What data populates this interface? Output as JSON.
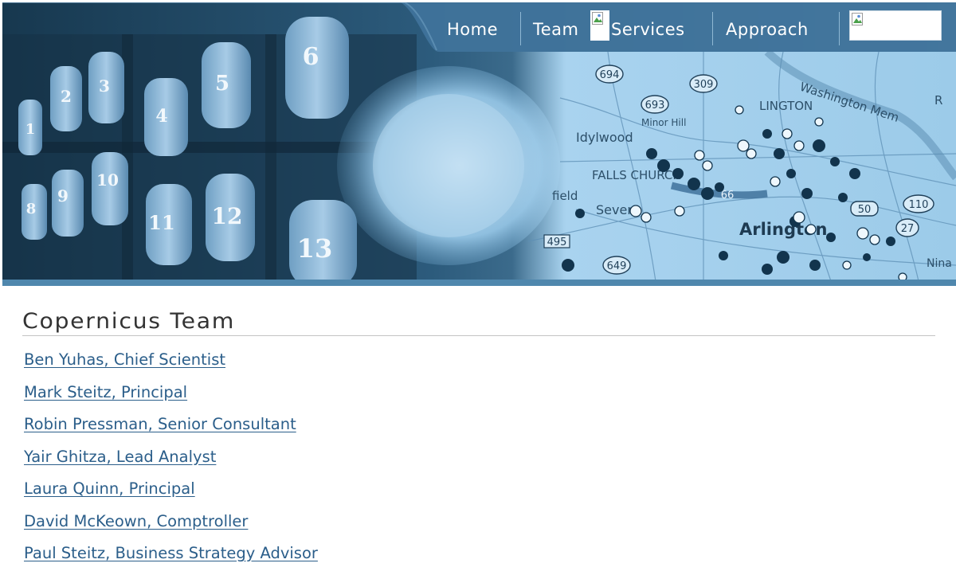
{
  "nav": {
    "items": [
      {
        "label": "Home"
      },
      {
        "label": "Team"
      },
      {
        "label": "Services"
      },
      {
        "label": "Approach"
      }
    ]
  },
  "banner": {
    "mailbox_numbers": [
      "1",
      "2",
      "3",
      "4",
      "5",
      "6",
      "8",
      "9",
      "10",
      "11",
      "12",
      "13"
    ],
    "map_road_labels": [
      "694",
      "309",
      "693",
      "66",
      "50",
      "110",
      "27",
      "495",
      "649"
    ],
    "map_place_labels": [
      "Minor Hill",
      "Idylwood",
      "FALLS CHURCH",
      "Arlington",
      "Seven",
      "LINGTON",
      "Washington Mem",
      "field",
      "R",
      "Nina"
    ]
  },
  "colors": {
    "banner_blue": "#3f7398",
    "link_blue": "#2b5e8a",
    "title_gray": "#333333"
  },
  "main": {
    "title": "Copernicus Team",
    "team": [
      {
        "label": "Ben Yuhas, Chief Scientist"
      },
      {
        "label": "Mark Steitz, Principal"
      },
      {
        "label": "Robin Pressman, Senior Consultant"
      },
      {
        "label": "Yair Ghitza, Lead Analyst"
      },
      {
        "label": "Laura Quinn, Principal"
      },
      {
        "label": "David McKeown, Comptroller"
      },
      {
        "label": "Paul Steitz, Business Strategy Advisor"
      }
    ]
  }
}
